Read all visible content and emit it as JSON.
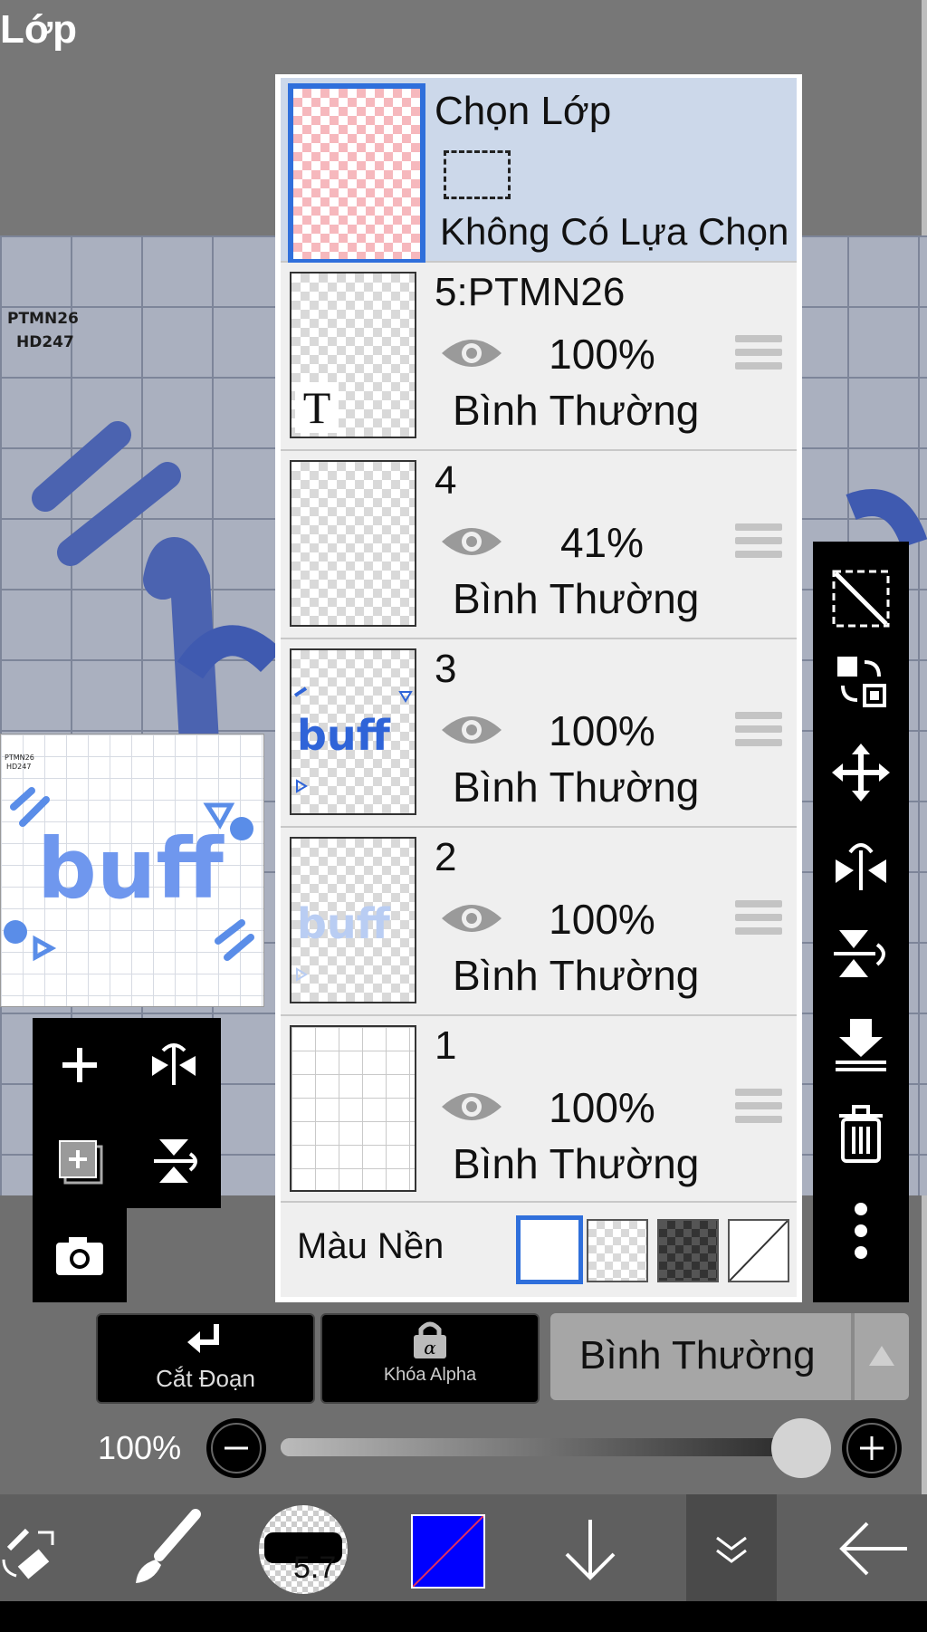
{
  "app": {
    "title": "Lớp"
  },
  "canvas": {
    "label_line1": "PTMN26",
    "label_line2": "HD247"
  },
  "selection_layer": {
    "title": "Chọn Lớp",
    "status": "Không Có Lựa Chọn"
  },
  "layers": [
    {
      "name": "5:PTMN26",
      "opacity": "100%",
      "blend": "Bình Thường",
      "type": "text"
    },
    {
      "name": "4",
      "opacity": "41%",
      "blend": "Bình Thường",
      "type": "empty"
    },
    {
      "name": "3",
      "opacity": "100%",
      "blend": "Bình Thường",
      "type": "image"
    },
    {
      "name": "2",
      "opacity": "100%",
      "blend": "Bình Thường",
      "type": "image-faded"
    },
    {
      "name": "1",
      "opacity": "100%",
      "blend": "Bình Thường",
      "type": "grid"
    }
  ],
  "background": {
    "label": "Màu Nền"
  },
  "buttons": {
    "clipping": "Cắt Đoạn",
    "alpha_lock": "Khóa Alpha"
  },
  "blend_mode": {
    "value": "Bình Thường"
  },
  "opacity_slider": {
    "value_text": "100%",
    "value": 1.0
  },
  "brush": {
    "size": "5.7"
  },
  "colors": {
    "accent": "#2f6fdb",
    "current_color": "#0000ff",
    "selected_row": "#ccd8ea"
  }
}
